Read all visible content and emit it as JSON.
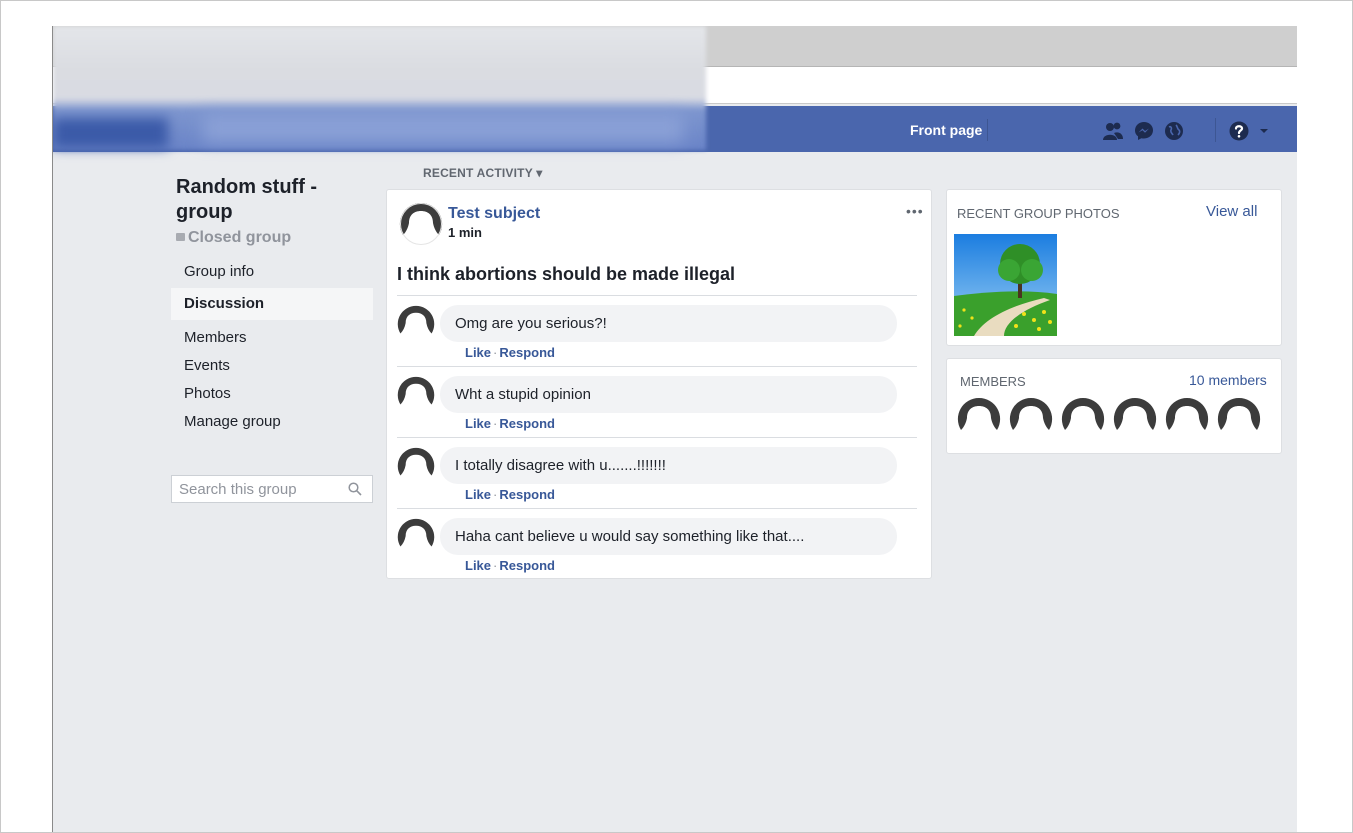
{
  "nav": {
    "front_page": "Front page"
  },
  "sidebar": {
    "group_title": "Random stuff -group",
    "privacy": "Closed group",
    "items": [
      {
        "label": "Group info"
      },
      {
        "label": "Discussion",
        "active": true
      },
      {
        "label": "Members"
      },
      {
        "label": "Events"
      },
      {
        "label": "Photos"
      },
      {
        "label": "Manage group"
      }
    ],
    "search_placeholder": "Search this group"
  },
  "feed": {
    "section_label": "RECENT ACTIVITY ▾",
    "post": {
      "author": "Test subject",
      "time": "1 min",
      "more": "•••",
      "text": "I think abortions should be made illegal",
      "comments": [
        {
          "text": "Omg are you serious?!",
          "like": "Like",
          "respond": "Respond"
        },
        {
          "text": "Wht a stupid opinion",
          "like": "Like",
          "respond": "Respond"
        },
        {
          "text": "I totally disagree with u.......!!!!!!!",
          "like": "Like",
          "respond": "Respond"
        },
        {
          "text": "Haha cant believe u would say something like that....",
          "like": "Like",
          "respond": "Respond"
        }
      ]
    }
  },
  "right": {
    "photos_heading": "RECENT GROUP PHOTOS",
    "photos_link": "View all",
    "members_heading": "MEMBERS",
    "members_link": "10 members"
  },
  "colors": {
    "brand_blue": "#4a66ad",
    "link": "#385898",
    "page_bg": "#e9ebee"
  }
}
